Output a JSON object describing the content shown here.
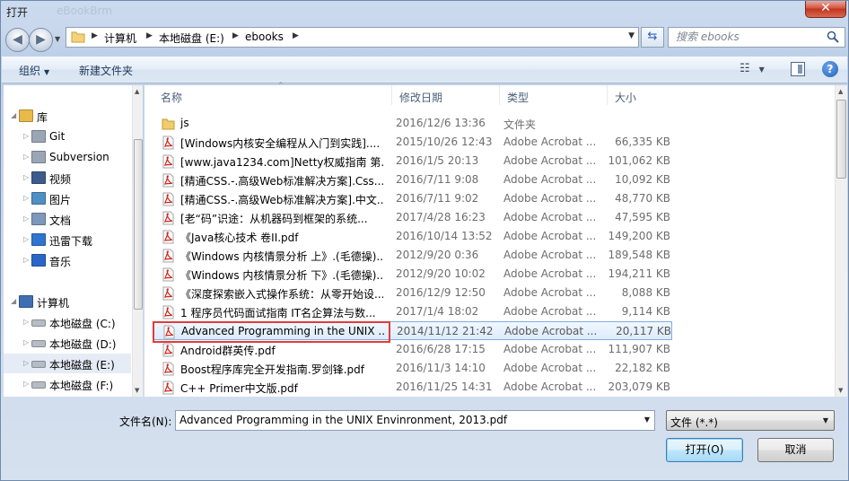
{
  "window": {
    "title": "打开",
    "ghost_title": "eBookBrm"
  },
  "address": {
    "crumbs": [
      "计算机",
      "本地磁盘 (E:)",
      "ebooks"
    ]
  },
  "search": {
    "placeholder": "搜索 ebooks"
  },
  "toolbar": {
    "organize": "组织",
    "new_folder": "新建文件夹"
  },
  "nav": {
    "items": [
      {
        "label": "库",
        "icon": "library-icon"
      },
      {
        "label": "Git",
        "icon": "git-library-icon"
      },
      {
        "label": "Subversion",
        "icon": "svn-library-icon"
      },
      {
        "label": "视频",
        "icon": "video-library-icon"
      },
      {
        "label": "图片",
        "icon": "pictures-library-icon"
      },
      {
        "label": "文档",
        "icon": "documents-library-icon"
      },
      {
        "label": "迅雷下载",
        "icon": "thunder-download-icon"
      },
      {
        "label": "音乐",
        "icon": "music-library-icon"
      },
      {
        "label": "计算机",
        "icon": "computer-icon"
      },
      {
        "label": "本地磁盘 (C:)",
        "icon": "system-drive-icon"
      },
      {
        "label": "本地磁盘 (D:)",
        "icon": "drive-icon"
      },
      {
        "label": "本地磁盘 (E:)",
        "icon": "drive-icon"
      },
      {
        "label": "本地磁盘 (F:)",
        "icon": "drive-icon"
      }
    ],
    "selected_index": 11
  },
  "columns": {
    "name": "名称",
    "date": "修改日期",
    "type": "类型",
    "size": "大小"
  },
  "files": [
    {
      "name": "js",
      "date": "2016/12/6 13:36",
      "type": "文件夹",
      "size": "",
      "kind": "folder"
    },
    {
      "name": "[Windows内核安全编程从入门到实践]....",
      "date": "2015/10/26 12:43",
      "type": "Adobe Acrobat ...",
      "size": "66,335 KB",
      "kind": "pdf"
    },
    {
      "name": "[www.java1234.com]Netty权威指南 第...",
      "date": "2016/1/5 20:13",
      "type": "Adobe Acrobat ...",
      "size": "101,062 KB",
      "kind": "pdf"
    },
    {
      "name": "[精通CSS.-.高级Web标准解决方案].Css....",
      "date": "2016/7/11 9:08",
      "type": "Adobe Acrobat ...",
      "size": "10,092 KB",
      "kind": "pdf"
    },
    {
      "name": "[精通CSS.-.高级Web标准解决方案].中文...",
      "date": "2016/7/11 9:02",
      "type": "Adobe Acrobat ...",
      "size": "48,770 KB",
      "kind": "pdf"
    },
    {
      "name": "[老“码”识途：从机器码到框架的系统...",
      "date": "2017/4/28 16:23",
      "type": "Adobe Acrobat ...",
      "size": "47,595 KB",
      "kind": "pdf"
    },
    {
      "name": "《Java核心技术 卷II.pdf",
      "date": "2016/10/14 13:52",
      "type": "Adobe Acrobat ...",
      "size": "149,200 KB",
      "kind": "pdf"
    },
    {
      "name": "《Windows 内核情景分析 上》.(毛德操)...",
      "date": "2012/9/20 0:36",
      "type": "Adobe Acrobat ...",
      "size": "189,548 KB",
      "kind": "pdf"
    },
    {
      "name": "《Windows 内核情景分析 下》.(毛德操)...",
      "date": "2012/9/20 10:02",
      "type": "Adobe Acrobat ...",
      "size": "194,211 KB",
      "kind": "pdf"
    },
    {
      "name": "《深度探索嵌入式操作系统：从零开始设...",
      "date": "2016/12/9 12:50",
      "type": "Adobe Acrobat ...",
      "size": "8,088 KB",
      "kind": "pdf"
    },
    {
      "name": "1 程序员代码面试指南 IT名企算法与数...",
      "date": "2017/1/4 18:02",
      "type": "Adobe Acrobat ...",
      "size": "9,114 KB",
      "kind": "pdf"
    },
    {
      "name": "Advanced Programming in the UNIX ...",
      "date": "2014/11/12 21:42",
      "type": "Adobe Acrobat ...",
      "size": "20,117 KB",
      "kind": "pdf"
    },
    {
      "name": "Android群英传.pdf",
      "date": "2016/6/28 17:15",
      "type": "Adobe Acrobat ...",
      "size": "111,907 KB",
      "kind": "pdf"
    },
    {
      "name": "Boost程序库完全开发指南.罗剑锋.pdf",
      "date": "2016/11/3 14:10",
      "type": "Adobe Acrobat ...",
      "size": "22,182 KB",
      "kind": "pdf"
    },
    {
      "name": "C++  Primer中文版.pdf",
      "date": "2016/11/25 14:31",
      "type": "Adobe Acrobat ...",
      "size": "203,079 KB",
      "kind": "pdf"
    }
  ],
  "selected_file_index": 11,
  "bottom": {
    "filename_label": "文件名(N):",
    "filename_value": "Advanced Programming in the UNIX Envinronment, 2013.pdf",
    "filter": "文件 (*.*)",
    "open_label": "打开(O)",
    "cancel_label": "取消"
  },
  "colors": {
    "highlight_box": "#e23b3b",
    "selection": "#dcebfc",
    "accent": "#1e395b"
  }
}
